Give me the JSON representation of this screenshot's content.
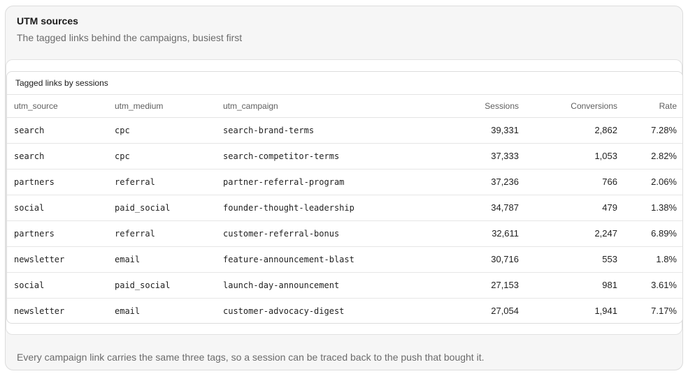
{
  "card": {
    "title": "UTM sources",
    "subtitle": "The tagged links behind the campaigns, busiest first",
    "footnote": "Every campaign link carries the same three tags, so a session can be traced back to the push that bought it."
  },
  "table": {
    "caption": "Tagged links by sessions",
    "columns": {
      "source": "utm_source",
      "medium": "utm_medium",
      "campaign": "utm_campaign",
      "sessions": "Sessions",
      "conversions": "Conversions",
      "rate": "Rate"
    },
    "rows": [
      {
        "source": "search",
        "medium": "cpc",
        "campaign": "search-brand-terms",
        "sessions": "39,331",
        "conversions": "2,862",
        "rate": "7.28%"
      },
      {
        "source": "search",
        "medium": "cpc",
        "campaign": "search-competitor-terms",
        "sessions": "37,333",
        "conversions": "1,053",
        "rate": "2.82%"
      },
      {
        "source": "partners",
        "medium": "referral",
        "campaign": "partner-referral-program",
        "sessions": "37,236",
        "conversions": "766",
        "rate": "2.06%"
      },
      {
        "source": "social",
        "medium": "paid_social",
        "campaign": "founder-thought-leadership",
        "sessions": "34,787",
        "conversions": "479",
        "rate": "1.38%"
      },
      {
        "source": "partners",
        "medium": "referral",
        "campaign": "customer-referral-bonus",
        "sessions": "32,611",
        "conversions": "2,247",
        "rate": "6.89%"
      },
      {
        "source": "newsletter",
        "medium": "email",
        "campaign": "feature-announcement-blast",
        "sessions": "30,716",
        "conversions": "553",
        "rate": "1.8%"
      },
      {
        "source": "social",
        "medium": "paid_social",
        "campaign": "launch-day-announcement",
        "sessions": "27,153",
        "conversions": "981",
        "rate": "3.61%"
      },
      {
        "source": "newsletter",
        "medium": "email",
        "campaign": "customer-advocacy-digest",
        "sessions": "27,054",
        "conversions": "1,941",
        "rate": "7.17%"
      }
    ]
  }
}
